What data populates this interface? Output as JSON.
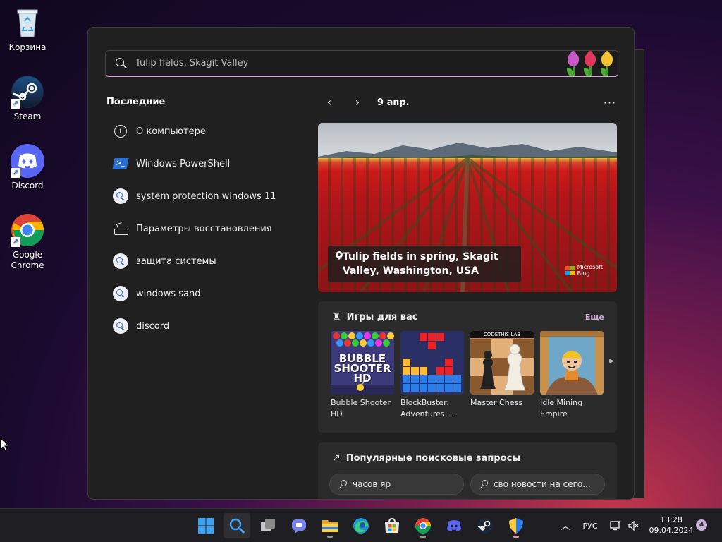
{
  "desktop": {
    "icons": [
      {
        "label": "Корзина",
        "icon": "recycle-bin-icon"
      },
      {
        "label": "Steam",
        "icon": "steam-icon"
      },
      {
        "label": "Discord",
        "icon": "discord-icon"
      },
      {
        "label": "Google Chrome",
        "icon": "chrome-icon"
      }
    ]
  },
  "search": {
    "placeholder": "Tulip fields, Skagit Valley",
    "value": ""
  },
  "recent": {
    "title": "Последние",
    "items": [
      {
        "label": "О компьютере",
        "icon": "info-icon"
      },
      {
        "label": "Windows PowerShell",
        "icon": "powershell-icon"
      },
      {
        "label": "system protection windows 11",
        "icon": "search-icon"
      },
      {
        "label": "Параметры восстановления",
        "icon": "recovery-icon"
      },
      {
        "label": "защита системы",
        "icon": "search-icon"
      },
      {
        "label": "windows sand",
        "icon": "search-icon"
      },
      {
        "label": "discord",
        "icon": "search-icon"
      }
    ]
  },
  "highlight": {
    "date": "9 апр.",
    "prev": "‹",
    "next": "›",
    "more": "···",
    "caption": "Tulip fields in spring, Skagit Valley, Washington, USA",
    "brand_line1": "Microsoft",
    "brand_line2": "Bing"
  },
  "games": {
    "title": "Игры для вас",
    "more": "Еще",
    "items": [
      {
        "name": "Bubble Shooter HD",
        "art": "BUBBLE SHOOTER HD"
      },
      {
        "name": "BlockBuster: Adventures ...",
        "art": ""
      },
      {
        "name": "Master Chess",
        "art": "CODETHIS LAB"
      },
      {
        "name": "Idle Mining Empire",
        "art": ""
      }
    ]
  },
  "popular": {
    "title": "Популярные поисковые запросы",
    "items": [
      "часов яр",
      "сво новости на сего..."
    ]
  },
  "taskbar": {
    "apps": [
      "windows-start",
      "search",
      "task-view",
      "teams-chat",
      "file-explorer",
      "edge",
      "store",
      "chrome",
      "discord",
      "steam",
      "defender"
    ],
    "lang": "РУС",
    "time": "13:28",
    "date": "09.04.2024",
    "notifications": "4"
  },
  "colors": {
    "accent": "#d9a6d6",
    "panel": "#202020",
    "card": "#2b2b2b"
  }
}
